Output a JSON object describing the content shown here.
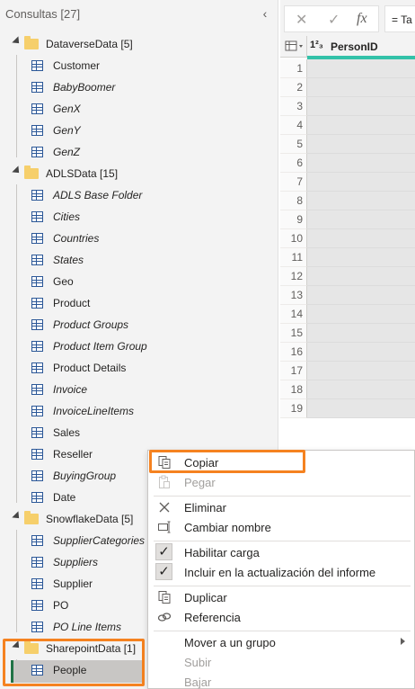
{
  "queries_pane": {
    "title": "Consultas [27]",
    "collapse_glyph": "‹",
    "groups": [
      {
        "label": "DataverseData [5]",
        "items": [
          {
            "label": "Customer",
            "italic": false
          },
          {
            "label": "BabyBoomer",
            "italic": true
          },
          {
            "label": "GenX",
            "italic": true
          },
          {
            "label": "GenY",
            "italic": true
          },
          {
            "label": "GenZ",
            "italic": true
          }
        ]
      },
      {
        "label": "ADLSData [15]",
        "items": [
          {
            "label": "ADLS Base Folder",
            "italic": true
          },
          {
            "label": "Cities",
            "italic": true
          },
          {
            "label": "Countries",
            "italic": true
          },
          {
            "label": "States",
            "italic": true
          },
          {
            "label": "Geo",
            "italic": false
          },
          {
            "label": "Product",
            "italic": false
          },
          {
            "label": "Product Groups",
            "italic": true
          },
          {
            "label": "Product Item Group",
            "italic": true
          },
          {
            "label": "Product Details",
            "italic": false
          },
          {
            "label": "Invoice",
            "italic": true
          },
          {
            "label": "InvoiceLineItems",
            "italic": true
          },
          {
            "label": "Sales",
            "italic": false
          },
          {
            "label": "Reseller",
            "italic": false
          },
          {
            "label": "BuyingGroup",
            "italic": true
          },
          {
            "label": "Date",
            "italic": false
          }
        ]
      },
      {
        "label": "SnowflakeData [5]",
        "items": [
          {
            "label": "SupplierCategories",
            "italic": true
          },
          {
            "label": "Suppliers",
            "italic": true
          },
          {
            "label": "Supplier",
            "italic": false
          },
          {
            "label": "PO",
            "italic": false
          },
          {
            "label": "PO Line Items",
            "italic": true
          }
        ]
      },
      {
        "label": "SharepointData [1]",
        "items": [
          {
            "label": "People",
            "italic": false
          }
        ]
      }
    ]
  },
  "formula_bar": {
    "cancel_glyph": "✕",
    "confirm_glyph": "✓",
    "fx_glyph": "fx",
    "formula_text": "= Ta"
  },
  "grid": {
    "type_icon": "1²₃",
    "column_name": "PersonID",
    "accent_color": "#33c2a9",
    "row_numbers": [
      "1",
      "2",
      "3",
      "4",
      "5",
      "6",
      "7",
      "8",
      "9",
      "10",
      "11",
      "12",
      "13",
      "14",
      "15",
      "16",
      "17",
      "18",
      "19"
    ]
  },
  "context_menu": {
    "copy": "Copiar",
    "paste": "Pegar",
    "delete": "Eliminar",
    "rename": "Cambiar nombre",
    "enable_load": "Habilitar carga",
    "include_refresh": "Incluir en la actualización del informe",
    "duplicate": "Duplicar",
    "reference": "Referencia",
    "move_to_group": "Mover a un grupo",
    "move_up": "Subir",
    "move_down": "Bajar"
  },
  "colors": {
    "highlight": "#f58220",
    "selected_row": "#c8c6c4",
    "table_icon": "#2b5797",
    "folder": "#f6cf6b"
  }
}
